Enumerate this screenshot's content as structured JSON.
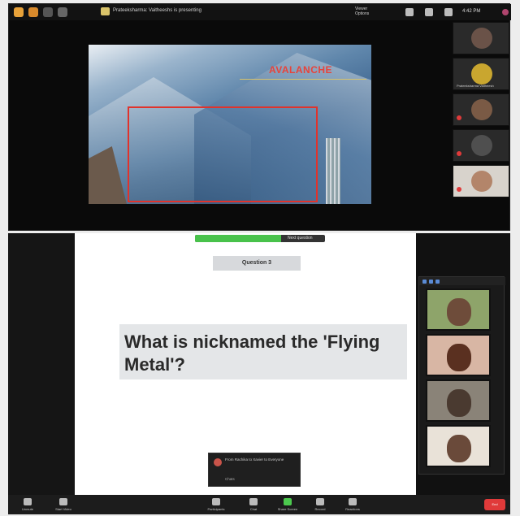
{
  "top_meeting": {
    "share_title": "Prateeksharma: Vaitheeshs is presenting",
    "viewer_options": [
      "Viewer",
      "Options"
    ],
    "clock": "4:42 PM",
    "slide": {
      "title": "AVALANCHE"
    },
    "gallery": [
      {
        "name": ""
      },
      {
        "name": "Prateeksharma Vaitheesh"
      },
      {
        "name": ""
      },
      {
        "name": ""
      },
      {
        "name": ""
      }
    ],
    "colors": {
      "slide_title": "#e8433a",
      "highlight_box": "#e0332c",
      "recording": "#b0456e"
    }
  },
  "bottom_meeting": {
    "timer_label": "Next question",
    "timer_progress": 0.66,
    "question_label": "Question 3",
    "question_text": "What is nicknamed the 'Flying Metal'?",
    "gallery": [
      {
        "name": ""
      },
      {
        "name": ""
      },
      {
        "name": ""
      },
      {
        "name": ""
      }
    ],
    "chat": {
      "message": "From Rachika to Xavier to Everyone",
      "sub": "Chats"
    },
    "toolbar": [
      {
        "label": "Unmute",
        "icon": "microphone-icon"
      },
      {
        "label": "Start Video",
        "icon": "video-camera-icon"
      },
      {
        "label": "Participants",
        "icon": "participants-icon"
      },
      {
        "label": "Chat",
        "icon": "chat-icon"
      },
      {
        "label": "Share Screen",
        "icon": "share-screen-icon"
      },
      {
        "label": "Record",
        "icon": "record-icon"
      },
      {
        "label": "Reactions",
        "icon": "reactions-icon"
      }
    ],
    "end_label": "End",
    "colors": {
      "timer": "#48c24b",
      "end": "#e03a3a"
    }
  }
}
